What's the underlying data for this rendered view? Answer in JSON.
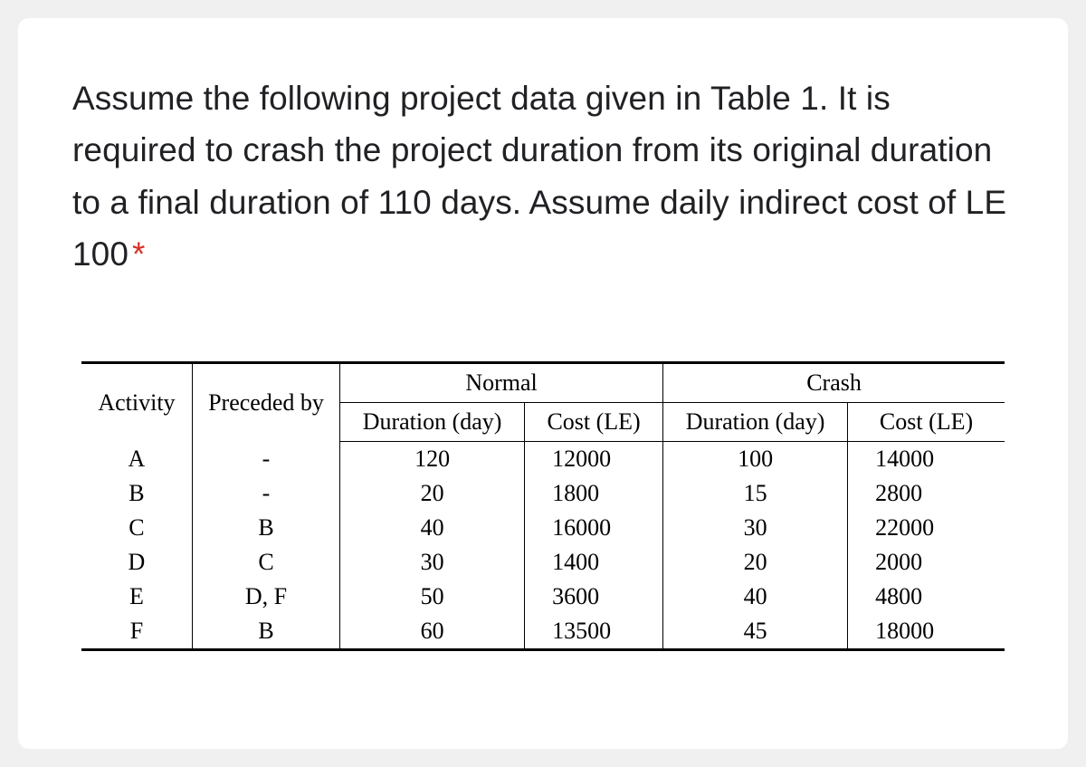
{
  "question": {
    "text": "Assume the following project data given in Table 1. It is required to crash the project duration from its original duration to a final duration of 110 days. Assume daily indirect cost of LE 100",
    "required_marker": "*"
  },
  "table": {
    "headers": {
      "activity": "Activity",
      "preceded_by": "Preceded by",
      "normal_group": "Normal",
      "crash_group": "Crash",
      "duration_day": "Duration (day)",
      "cost_le": "Cost (LE)"
    },
    "rows": [
      {
        "activity": "A",
        "preceded_by": "-",
        "normal_duration": "120",
        "normal_cost": "12000",
        "crash_duration": "100",
        "crash_cost": "14000"
      },
      {
        "activity": "B",
        "preceded_by": "-",
        "normal_duration": "20",
        "normal_cost": "1800",
        "crash_duration": "15",
        "crash_cost": "2800"
      },
      {
        "activity": "C",
        "preceded_by": "B",
        "normal_duration": "40",
        "normal_cost": "16000",
        "crash_duration": "30",
        "crash_cost": "22000"
      },
      {
        "activity": "D",
        "preceded_by": "C",
        "normal_duration": "30",
        "normal_cost": "1400",
        "crash_duration": "20",
        "crash_cost": "2000"
      },
      {
        "activity": "E",
        "preceded_by": "D, F",
        "normal_duration": "50",
        "normal_cost": "3600",
        "crash_duration": "40",
        "crash_cost": "4800"
      },
      {
        "activity": "F",
        "preceded_by": "B",
        "normal_duration": "60",
        "normal_cost": "13500",
        "crash_duration": "45",
        "crash_cost": "18000"
      }
    ]
  }
}
